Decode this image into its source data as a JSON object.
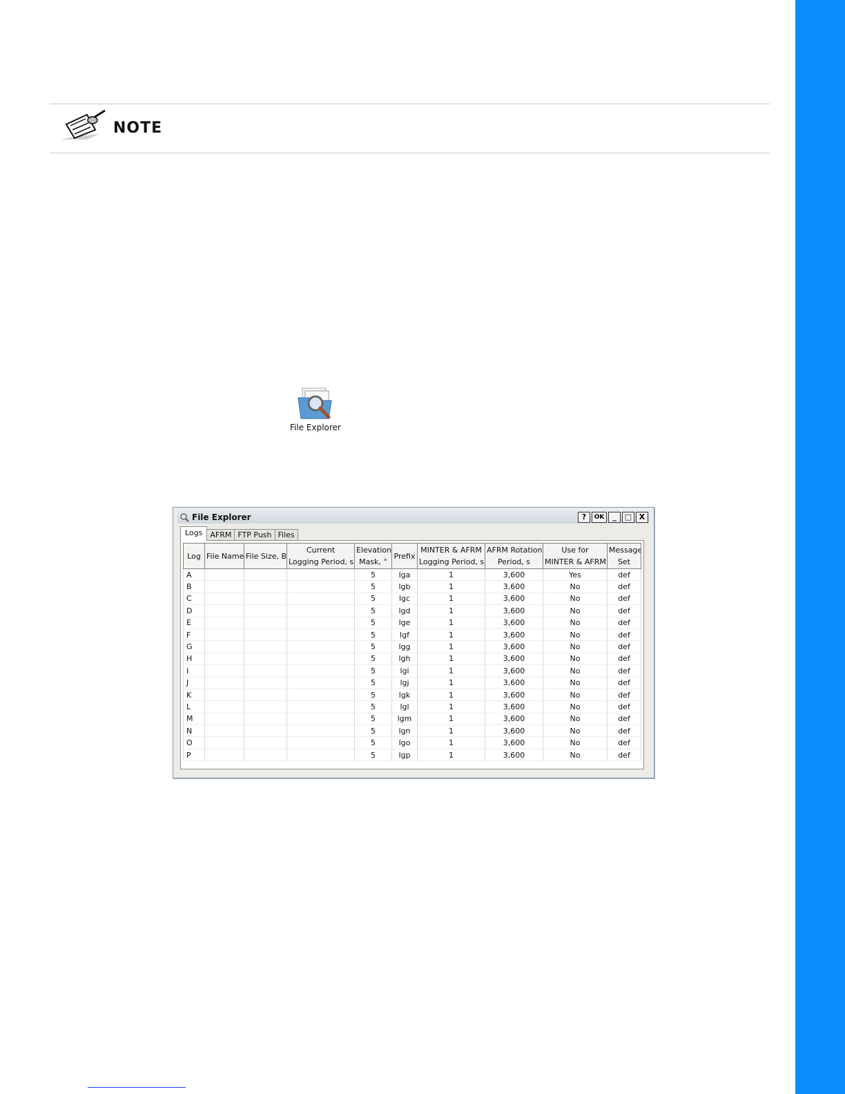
{
  "note": {
    "label": "NOTE"
  },
  "desktop_icon": {
    "label": "File Explorer"
  },
  "window": {
    "title": "File Explorer",
    "buttons": {
      "help": "?",
      "ok": "OK",
      "minimize": "_",
      "maximize": "□",
      "close": "X"
    },
    "tabs": [
      "Logs",
      "AFRM",
      "FTP Push",
      "Files"
    ],
    "table": {
      "columns": [
        [
          "Log"
        ],
        [
          "File Name"
        ],
        [
          "File Size, B"
        ],
        [
          "Current",
          "Logging Period, s"
        ],
        [
          "Elevation",
          "Mask, °"
        ],
        [
          "Prefix"
        ],
        [
          "MINTER & AFRM",
          "Logging Period, s"
        ],
        [
          "AFRM Rotation",
          "Period, s"
        ],
        [
          "Use for",
          "MINTER & AFRM"
        ],
        [
          "Message",
          "Set"
        ]
      ],
      "rows": [
        [
          "A",
          "",
          "",
          "",
          "5",
          "lga",
          "1",
          "3,600",
          "Yes",
          "def"
        ],
        [
          "B",
          "",
          "",
          "",
          "5",
          "lgb",
          "1",
          "3,600",
          "No",
          "def"
        ],
        [
          "C",
          "",
          "",
          "",
          "5",
          "lgc",
          "1",
          "3,600",
          "No",
          "def"
        ],
        [
          "D",
          "",
          "",
          "",
          "5",
          "lgd",
          "1",
          "3,600",
          "No",
          "def"
        ],
        [
          "E",
          "",
          "",
          "",
          "5",
          "lge",
          "1",
          "3,600",
          "No",
          "def"
        ],
        [
          "F",
          "",
          "",
          "",
          "5",
          "lgf",
          "1",
          "3,600",
          "No",
          "def"
        ],
        [
          "G",
          "",
          "",
          "",
          "5",
          "lgg",
          "1",
          "3,600",
          "No",
          "def"
        ],
        [
          "H",
          "",
          "",
          "",
          "5",
          "lgh",
          "1",
          "3,600",
          "No",
          "def"
        ],
        [
          "I",
          "",
          "",
          "",
          "5",
          "lgi",
          "1",
          "3,600",
          "No",
          "def"
        ],
        [
          "J",
          "",
          "",
          "",
          "5",
          "lgj",
          "1",
          "3,600",
          "No",
          "def"
        ],
        [
          "K",
          "",
          "",
          "",
          "5",
          "lgk",
          "1",
          "3,600",
          "No",
          "def"
        ],
        [
          "L",
          "",
          "",
          "",
          "5",
          "lgl",
          "1",
          "3,600",
          "No",
          "def"
        ],
        [
          "M",
          "",
          "",
          "",
          "5",
          "lgm",
          "1",
          "3,600",
          "No",
          "def"
        ],
        [
          "N",
          "",
          "",
          "",
          "5",
          "lgn",
          "1",
          "3,600",
          "No",
          "def"
        ],
        [
          "O",
          "",
          "",
          "",
          "5",
          "lgo",
          "1",
          "3,600",
          "No",
          "def"
        ],
        [
          "P",
          "",
          "",
          "",
          "5",
          "lgp",
          "1",
          "3,600",
          "No",
          "def"
        ]
      ]
    }
  },
  "colors": {
    "side_bar": "#0a8cff",
    "rule": "#c9c9c9",
    "link": "#1a3cff"
  }
}
